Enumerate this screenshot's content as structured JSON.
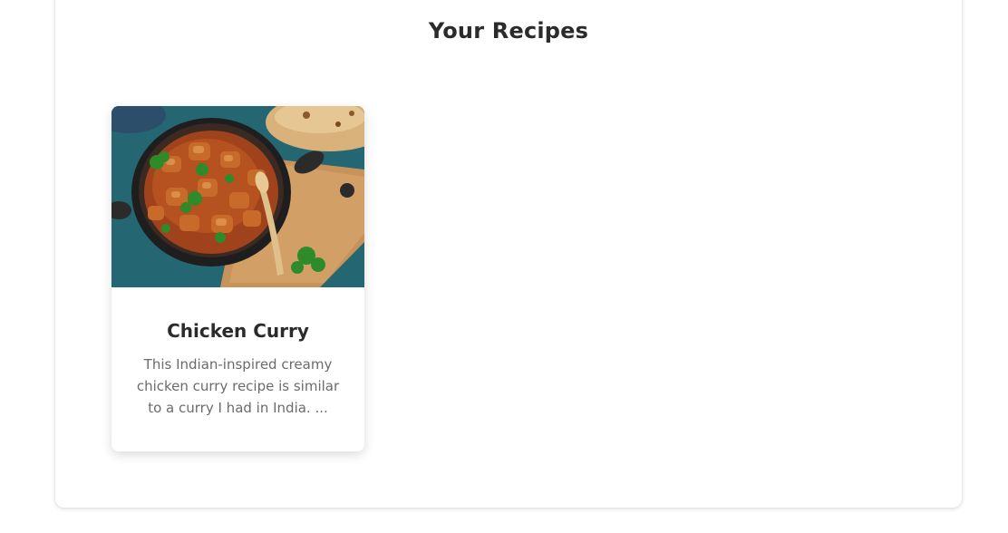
{
  "page": {
    "title": "Your Recipes"
  },
  "recipes": [
    {
      "title": "Chicken Curry",
      "description": "This Indian-inspired creamy chicken curry recipe is similar to a curry I had in India. ...",
      "image_subject": "chicken-curry-photo"
    }
  ],
  "colors": {
    "heading_text": "#2b2b2b",
    "body_text": "#6b6b6b",
    "card_background": "#ffffff",
    "page_background": "#ffffff"
  }
}
